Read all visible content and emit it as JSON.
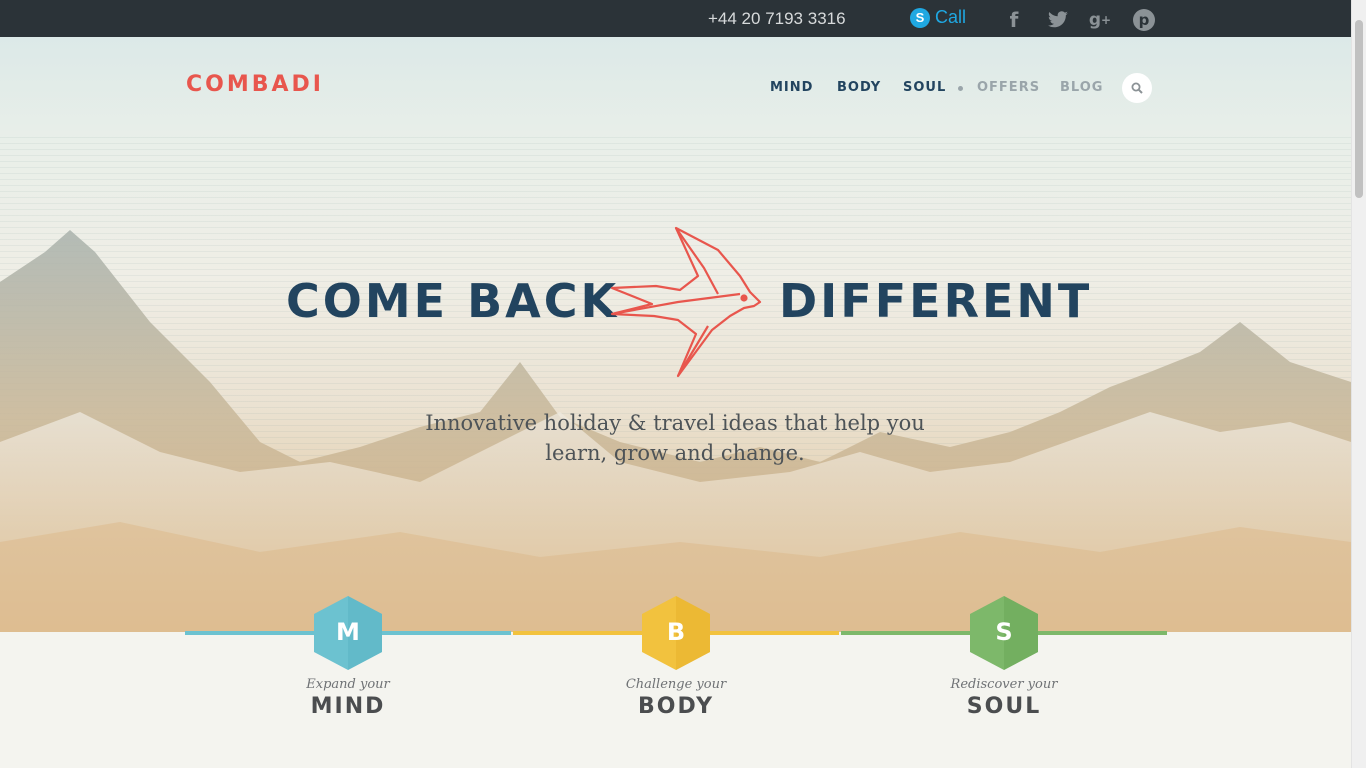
{
  "topbar": {
    "phone": "+44 20 7193 3316",
    "call_label": "Call",
    "skype_glyph": "S",
    "social": [
      {
        "name": "facebook-icon",
        "glyph": "f"
      },
      {
        "name": "twitter-icon",
        "glyph": "twitter"
      },
      {
        "name": "google-plus-icon",
        "glyph": "g+"
      },
      {
        "name": "pinterest-icon",
        "glyph": "p"
      }
    ]
  },
  "header": {
    "logo": "COMBADI",
    "nav": [
      "MIND",
      "BODY",
      "SOUL",
      "OFFERS",
      "BLOG"
    ],
    "search_icon": "search-icon"
  },
  "hero": {
    "headline_left": "COME BACK",
    "headline_right": "DIFFERENT",
    "subtitle_line1": "Innovative holiday & travel ideas that help you",
    "subtitle_line2": "learn, grow and change."
  },
  "categories": [
    {
      "letter": "M",
      "sub": "Expand your",
      "title": "MIND",
      "color": "#6cc2d0"
    },
    {
      "letter": "B",
      "sub": "Challenge your",
      "title": "BODY",
      "color": "#f2c23e"
    },
    {
      "letter": "S",
      "sub": "Rediscover your",
      "title": "SOUL",
      "color": "#7db86a"
    }
  ],
  "colors": {
    "brand_red": "#e8564d",
    "navy": "#22445f",
    "topbar": "#2b3338",
    "skype_blue": "#1fa8e2"
  }
}
